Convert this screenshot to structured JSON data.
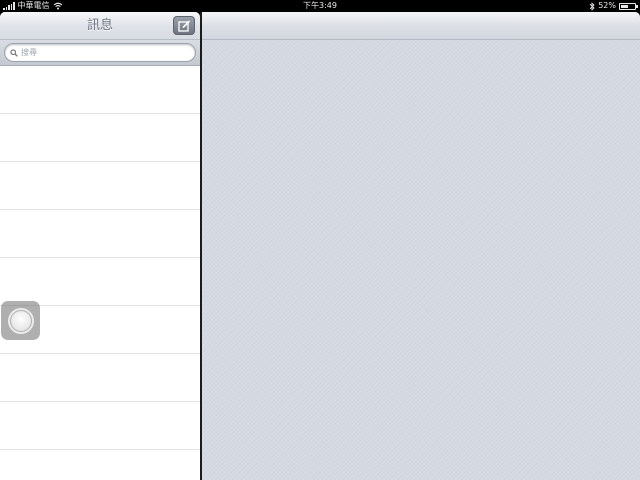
{
  "status_bar": {
    "carrier": "中華電信",
    "time": "下午3:49",
    "battery": "52%",
    "battery_level": 0.52,
    "icons": [
      "signal-bars-icon",
      "wifi-icon",
      "bluetooth-icon",
      "battery-icon"
    ]
  },
  "master": {
    "title": "訊息",
    "compose_icon": "compose-icon",
    "search": {
      "placeholder": "搜尋",
      "icon": "search-icon"
    },
    "row_count": 9
  },
  "detail": {
    "title": ""
  },
  "assistive_touch": {
    "icon": "assistive-touch-icon"
  }
}
